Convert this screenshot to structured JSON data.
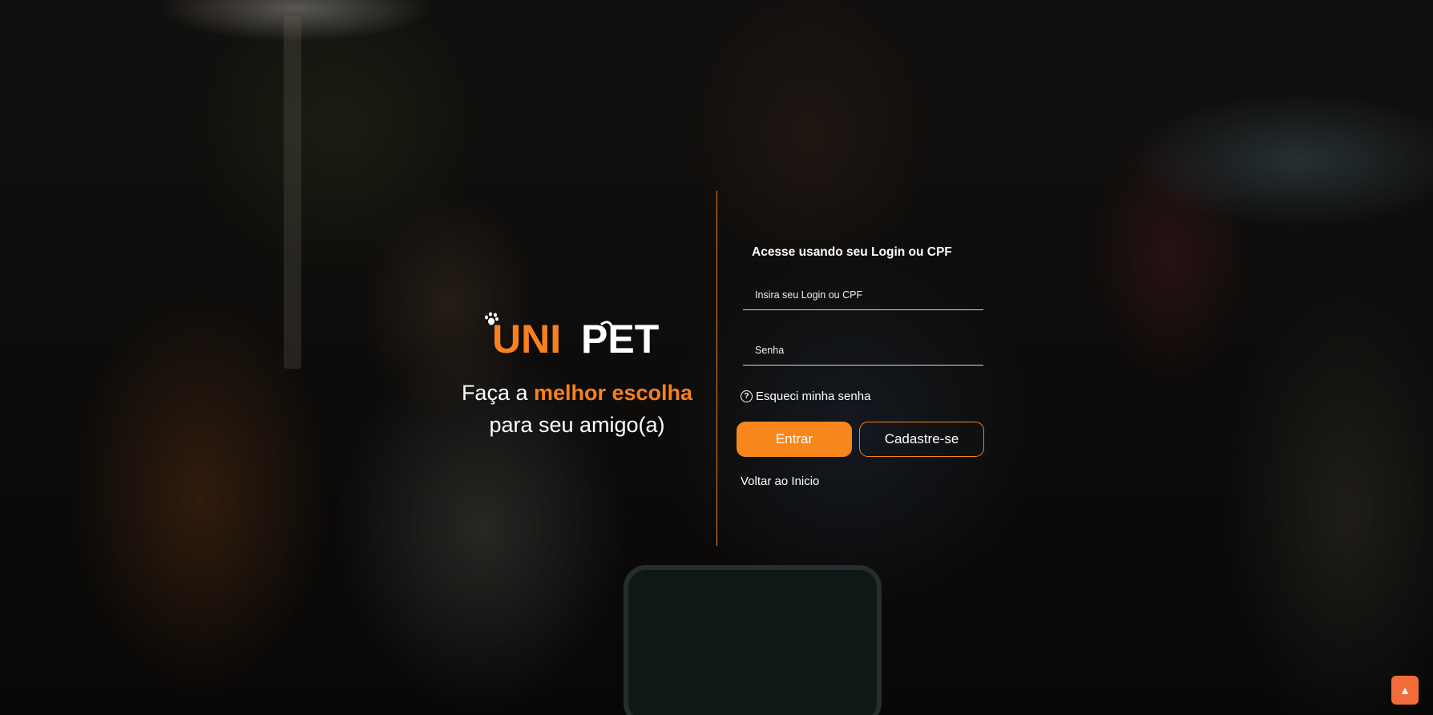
{
  "brand": {
    "logo_text_orange": "UNI",
    "logo_text_white": "PET",
    "tagline_prefix": "Faça a ",
    "tagline_highlight": "melhor escolha",
    "tagline_line2": "para seu amigo(a)"
  },
  "login": {
    "title": "Acesse usando seu Login ou CPF",
    "login_placeholder": "Insira seu Login ou CPF",
    "login_value": "",
    "password_placeholder": "Senha",
    "password_value": "",
    "forgot_label": "Esqueci minha senha",
    "forgot_icon": "question-circle-icon",
    "submit_label": "Entrar",
    "register_label": "Cadastre-se",
    "back_label": "Voltar ao Inicio"
  },
  "scroll_top": {
    "icon": "arrow-up-icon",
    "glyph": "▲"
  },
  "colors": {
    "accent": "#f7811f",
    "button_fill": "#f7861c",
    "scroll_button": "#f26b3a",
    "text": "#ffffff"
  }
}
